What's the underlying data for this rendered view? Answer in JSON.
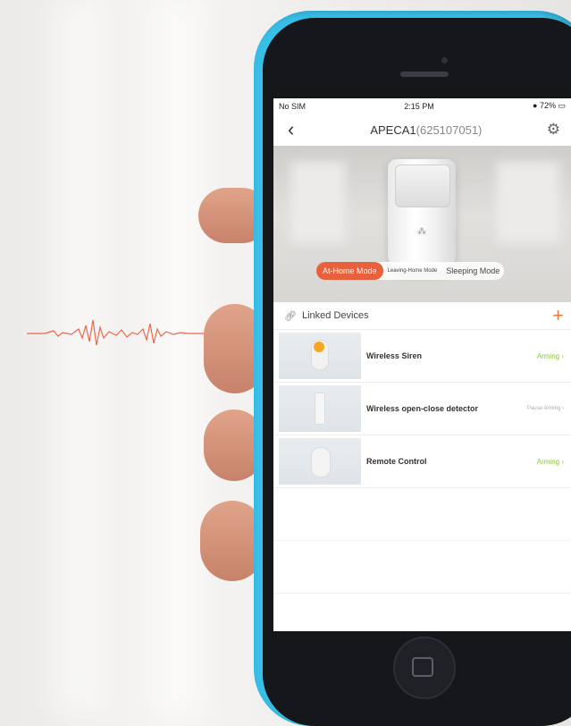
{
  "status_bar": {
    "carrier": "No SIM",
    "wifi_icon": "wifi-icon",
    "time": "2:15 PM",
    "battery": "72%"
  },
  "nav": {
    "back_icon": "chevron-left-icon",
    "title_name": "APECA1",
    "title_id": "(625107051)",
    "settings_icon": "gear-icon"
  },
  "modes": [
    {
      "label": "At-Home Mode",
      "active": true
    },
    {
      "label": "Leaving-Home Mode",
      "active": false
    },
    {
      "label": "Sleeping Mode",
      "active": false
    }
  ],
  "linked": {
    "title": "Linked Devices",
    "add_icon": "plus-icon"
  },
  "devices": [
    {
      "name": "Wireless Siren",
      "status": "Arming",
      "status_color": "#8cc43f"
    },
    {
      "name": "Wireless open-close detector",
      "status": "Pause Arming",
      "status_color": "#aaaaaa"
    },
    {
      "name": "Remote Control",
      "status": "Arming",
      "status_color": "#8cc43f"
    }
  ],
  "colors": {
    "accent": "#e8603c",
    "phone_body": "#38bfe8",
    "arming": "#8cc43f"
  }
}
